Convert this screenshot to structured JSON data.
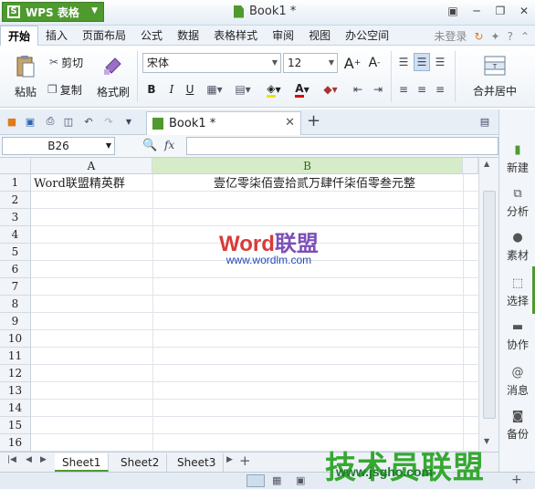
{
  "app": {
    "name": "WPS 表格",
    "logo": "S",
    "doc_title": "Book1 *"
  },
  "menu": {
    "items": [
      "开始",
      "插入",
      "页面布局",
      "公式",
      "数据",
      "表格样式",
      "审阅",
      "视图",
      "办公空间"
    ],
    "login": "未登录"
  },
  "ribbon": {
    "paste": "粘贴",
    "cut": "剪切",
    "copy": "复制",
    "format_painter": "格式刷",
    "font_name": "宋体",
    "font_size": "12",
    "grow": "A",
    "shrink": "A",
    "bold": "B",
    "italic": "I",
    "underline": "U",
    "font_color": "A",
    "merge_center": "合并居中"
  },
  "tab": {
    "title": "Book1 *",
    "add": "+"
  },
  "formula": {
    "name_box": "B26",
    "fx": "fx",
    "value": ""
  },
  "columns": [
    "A",
    "B"
  ],
  "rows": [
    "1",
    "2",
    "3",
    "4",
    "5",
    "6",
    "7",
    "8",
    "9",
    "10",
    "11",
    "12",
    "13",
    "14",
    "15",
    "16"
  ],
  "cells": {
    "A1": "Word联盟精英群",
    "B1": "壹亿零柒佰壹拾贰万肆仟柒佰零叁元整"
  },
  "watermark": {
    "word_red": "Word",
    "word_purple": "联盟",
    "url": "www.wordlm.com"
  },
  "sheets": [
    "Sheet1",
    "Sheet2",
    "Sheet3"
  ],
  "sidebar": [
    "新建",
    "分析",
    "素材",
    "选择",
    "协作",
    "消息",
    "备份"
  ],
  "brand": {
    "text": "技术员联盟",
    "url": "www.jsgho.com"
  },
  "colors": {
    "accent": "#4f9a2e",
    "brand_green": "#36a832"
  }
}
